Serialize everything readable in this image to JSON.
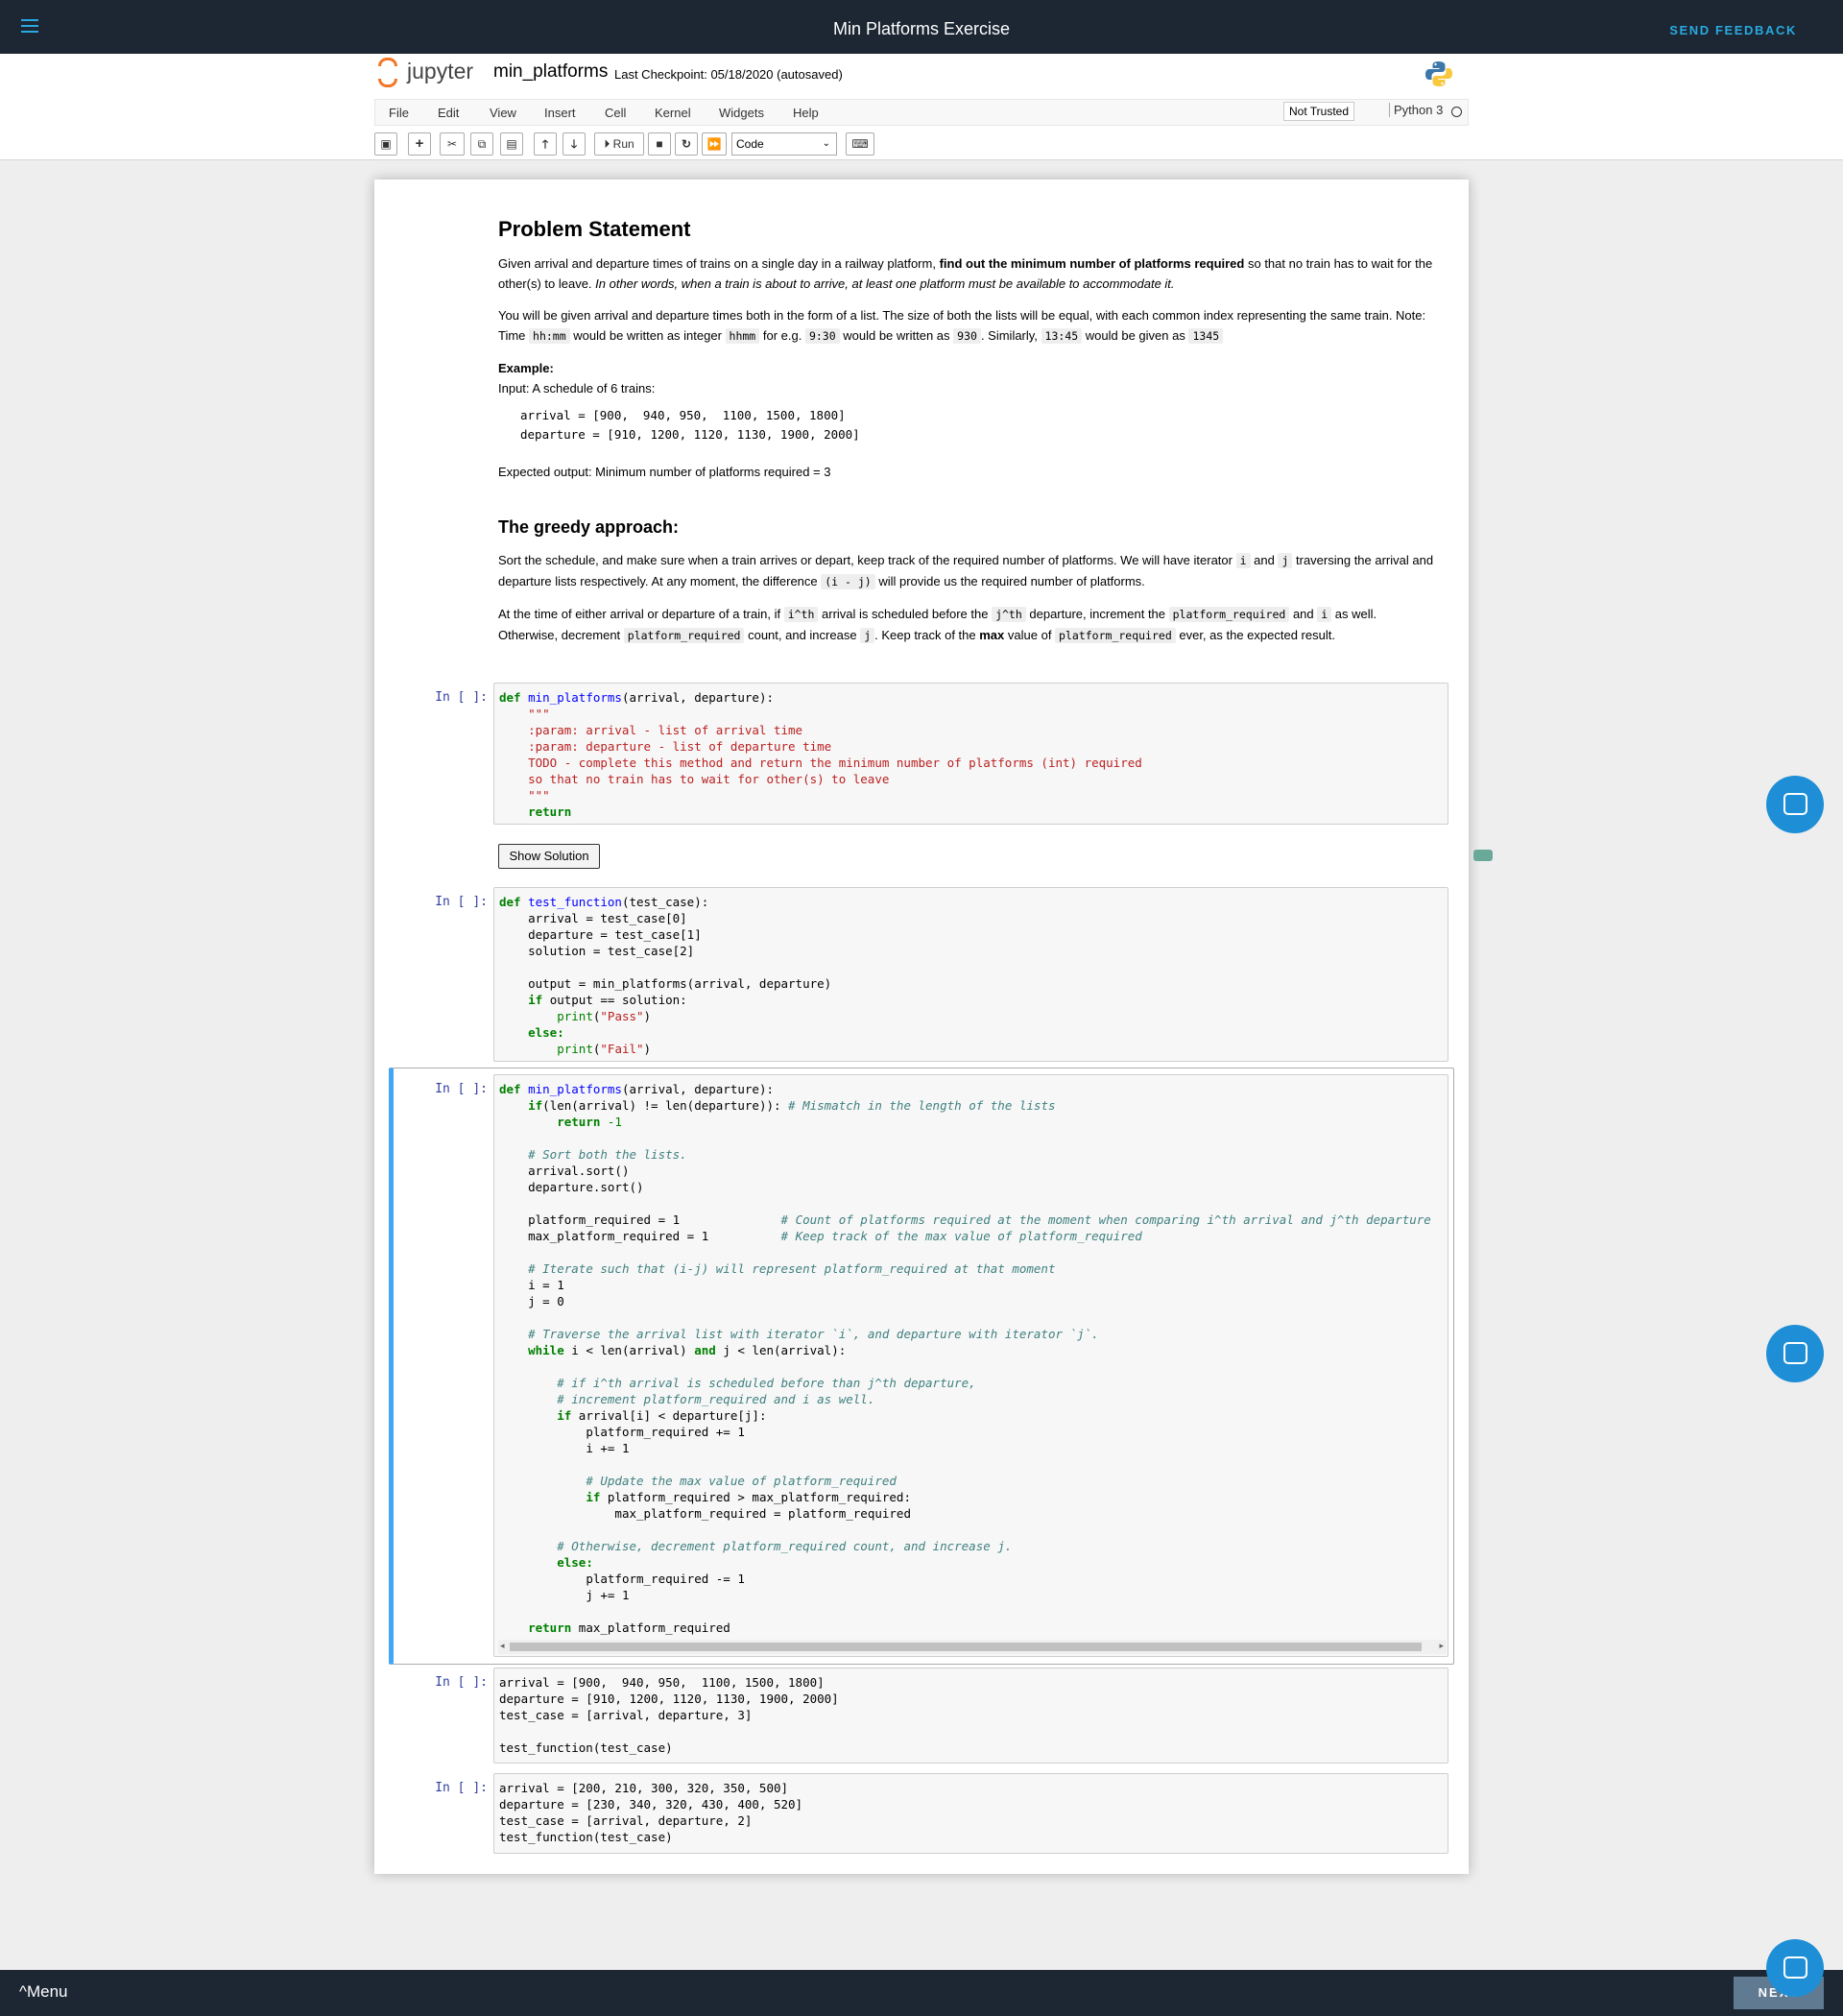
{
  "topbar": {
    "title": "Min Platforms Exercise",
    "feedback": "SEND FEEDBACK"
  },
  "jupyter": {
    "logo_text": "jupyter",
    "notebook_name": "min_platforms",
    "checkpoint": "Last Checkpoint: 05/18/2020  (autosaved)",
    "menu": [
      "File",
      "Edit",
      "View",
      "Insert",
      "Cell",
      "Kernel",
      "Widgets",
      "Help"
    ],
    "trusted": "Not Trusted",
    "kernel": "Python 3",
    "toolbar": {
      "run": "Run",
      "cell_type": "Code"
    }
  },
  "problem": {
    "heading": "Problem Statement",
    "p1_a": "Given arrival and departure times of trains on a single day in a railway platform, ",
    "p1_b": "find out the minimum number of platforms required",
    "p1_c": " so that no train has to wait for the other(s) to leave. ",
    "p1_d": "In other words, when a train is about to arrive, at least one platform must be available to accommodate it.",
    "p2_a": "You will be given arrival and departure times both in the form of a list. The size of both the lists will be equal, with each common index representing the same train. Note: Time ",
    "p2_c1": "hh:mm",
    "p2_b": " would be written as integer ",
    "p2_c2": "hhmm",
    "p2_c": " for e.g. ",
    "p2_c3": "9:30",
    "p2_d": " would be written as ",
    "p2_c4": "930",
    "p2_e": ". Similarly, ",
    "p2_c5": "13:45",
    "p2_f": " would be given as ",
    "p2_c6": "1345",
    "example_label": "Example:",
    "example_input": "Input: A schedule of 6 trains:",
    "example_code": "arrival = [900,  940, 950,  1100, 1500, 1800]\ndeparture = [910, 1200, 1120, 1130, 1900, 2000]",
    "expected": "Expected output: Minimum number of platforms required = 3"
  },
  "greedy": {
    "heading": "The greedy approach:",
    "p1_a": "Sort the schedule, and make sure when a train arrives or depart, keep track of the required number of platforms. We will have iterator ",
    "p1_c1": "i",
    "p1_b": " and ",
    "p1_c2": "j",
    "p1_c": " traversing the arrival and departure lists respectively. At any moment, the difference ",
    "p1_c3": "(i - j)",
    "p1_d": " will provide us the required number of platforms.",
    "p2_a": "At the time of either arrival or departure of a train, if ",
    "p2_c1": "i^th",
    "p2_b": " arrival is scheduled before the ",
    "p2_c2": "j^th",
    "p2_c": " departure, increment the ",
    "p2_c3": "platform_required",
    "p2_d": " and ",
    "p2_c4": "i",
    "p2_e": " as well. Otherwise, decrement ",
    "p2_c5": "platform_required",
    "p2_f": " count, and increase ",
    "p2_c6": "j",
    "p2_g": ". Keep track of the ",
    "p2_h": "max",
    "p2_i": " value of ",
    "p2_c7": "platform_required",
    "p2_j": " ever, as the expected result."
  },
  "cells": {
    "prompt": "In [ ]:",
    "show_solution": "Show Solution",
    "c1": {
      "l1_kw": "def",
      "l1_fn": "min_platforms",
      "l1_rest": "(arrival, departure):",
      "doc": "    \"\"\"\n    :param: arrival - list of arrival time\n    :param: departure - list of departure time\n    TODO - complete this method and return the minimum number of platforms (int) required\n    so that no train has to wait for other(s) to leave\n    \"\"\"",
      "ret": "return"
    },
    "c2": {
      "kw_def": "def",
      "fn": "test_function",
      "l1": "(test_case):",
      "l2": "arrival = test_case[0]",
      "l3": "departure = test_case[1]",
      "l4": "solution = test_case[2]",
      "l5": "output = min_platforms(arrival, departure)",
      "kw_if": "if",
      "l6": " output == solution:",
      "l7_fn": "print",
      "l7_str": "\"Pass\"",
      "kw_else": "else:",
      "l9_fn": "print",
      "l9_str": "\"Fail\""
    },
    "c3": {
      "kw_def": "def",
      "fn": "min_platforms",
      "l1": "(arrival, departure):",
      "l2_kw": "if",
      "l2_a": "(len(arrival) != len(departure)): ",
      "l2_cm": "# Mismatch in the length of the lists",
      "l3_kw": "return",
      "l3_n": " -1",
      "cm1": "# Sort both the lists.",
      "l5": "arrival.sort()",
      "l6": "departure.sort()",
      "l7": "platform_required = 1",
      "l7_cm": "# Count of platforms required at the moment when comparing i^th arrival and j^th departure",
      "l8": "max_platform_required = 1",
      "l8_cm": "# Keep track of the max value of platform_required",
      "cm2": "# Iterate such that (i-j) will represent platform_required at that moment",
      "l10": "i = 1",
      "l11": "j = 0",
      "cm3": "# Traverse the arrival list with iterator `i`, and departure with iterator `j`.",
      "l12_kw": "while",
      "l12_a": " i < len(arrival) ",
      "l12_and": "and",
      "l12_b": " j < len(arrival):",
      "cm4": "# if i^th arrival is scheduled before than j^th departure,",
      "cm5": "# increment platform_required and i as well.",
      "l15_kw": "if",
      "l15": " arrival[i] < departure[j]:",
      "l16": "platform_required += 1",
      "l17": "i += 1",
      "cm6": "# Update the max value of platform_required",
      "l19_kw": "if",
      "l19": " platform_required > max_platform_required:",
      "l20": "max_platform_required = platform_required",
      "cm7": "# Otherwise, decrement platform_required count, and increase j.",
      "l22_kw": "else:",
      "l23": "platform_required -= 1",
      "l24": "j += 1",
      "l25_kw": "return",
      "l25": " max_platform_required"
    },
    "c4": {
      "l1": "arrival = [900,  940, 950,  1100, 1500, 1800]",
      "l2": "departure = [910, 1200, 1120, 1130, 1900, 2000]",
      "l3": "test_case = [arrival, departure, 3]",
      "l4": "test_function(test_case)"
    },
    "c5": {
      "l1": "arrival = [200, 210, 300, 320, 350, 500]",
      "l2": "departure = [230, 340, 320, 430, 400, 520]",
      "l3": "test_case = [arrival, departure, 2]",
      "l4": "test_function(test_case)"
    }
  },
  "bottom": {
    "menu": "Menu",
    "next": "NEXT"
  }
}
